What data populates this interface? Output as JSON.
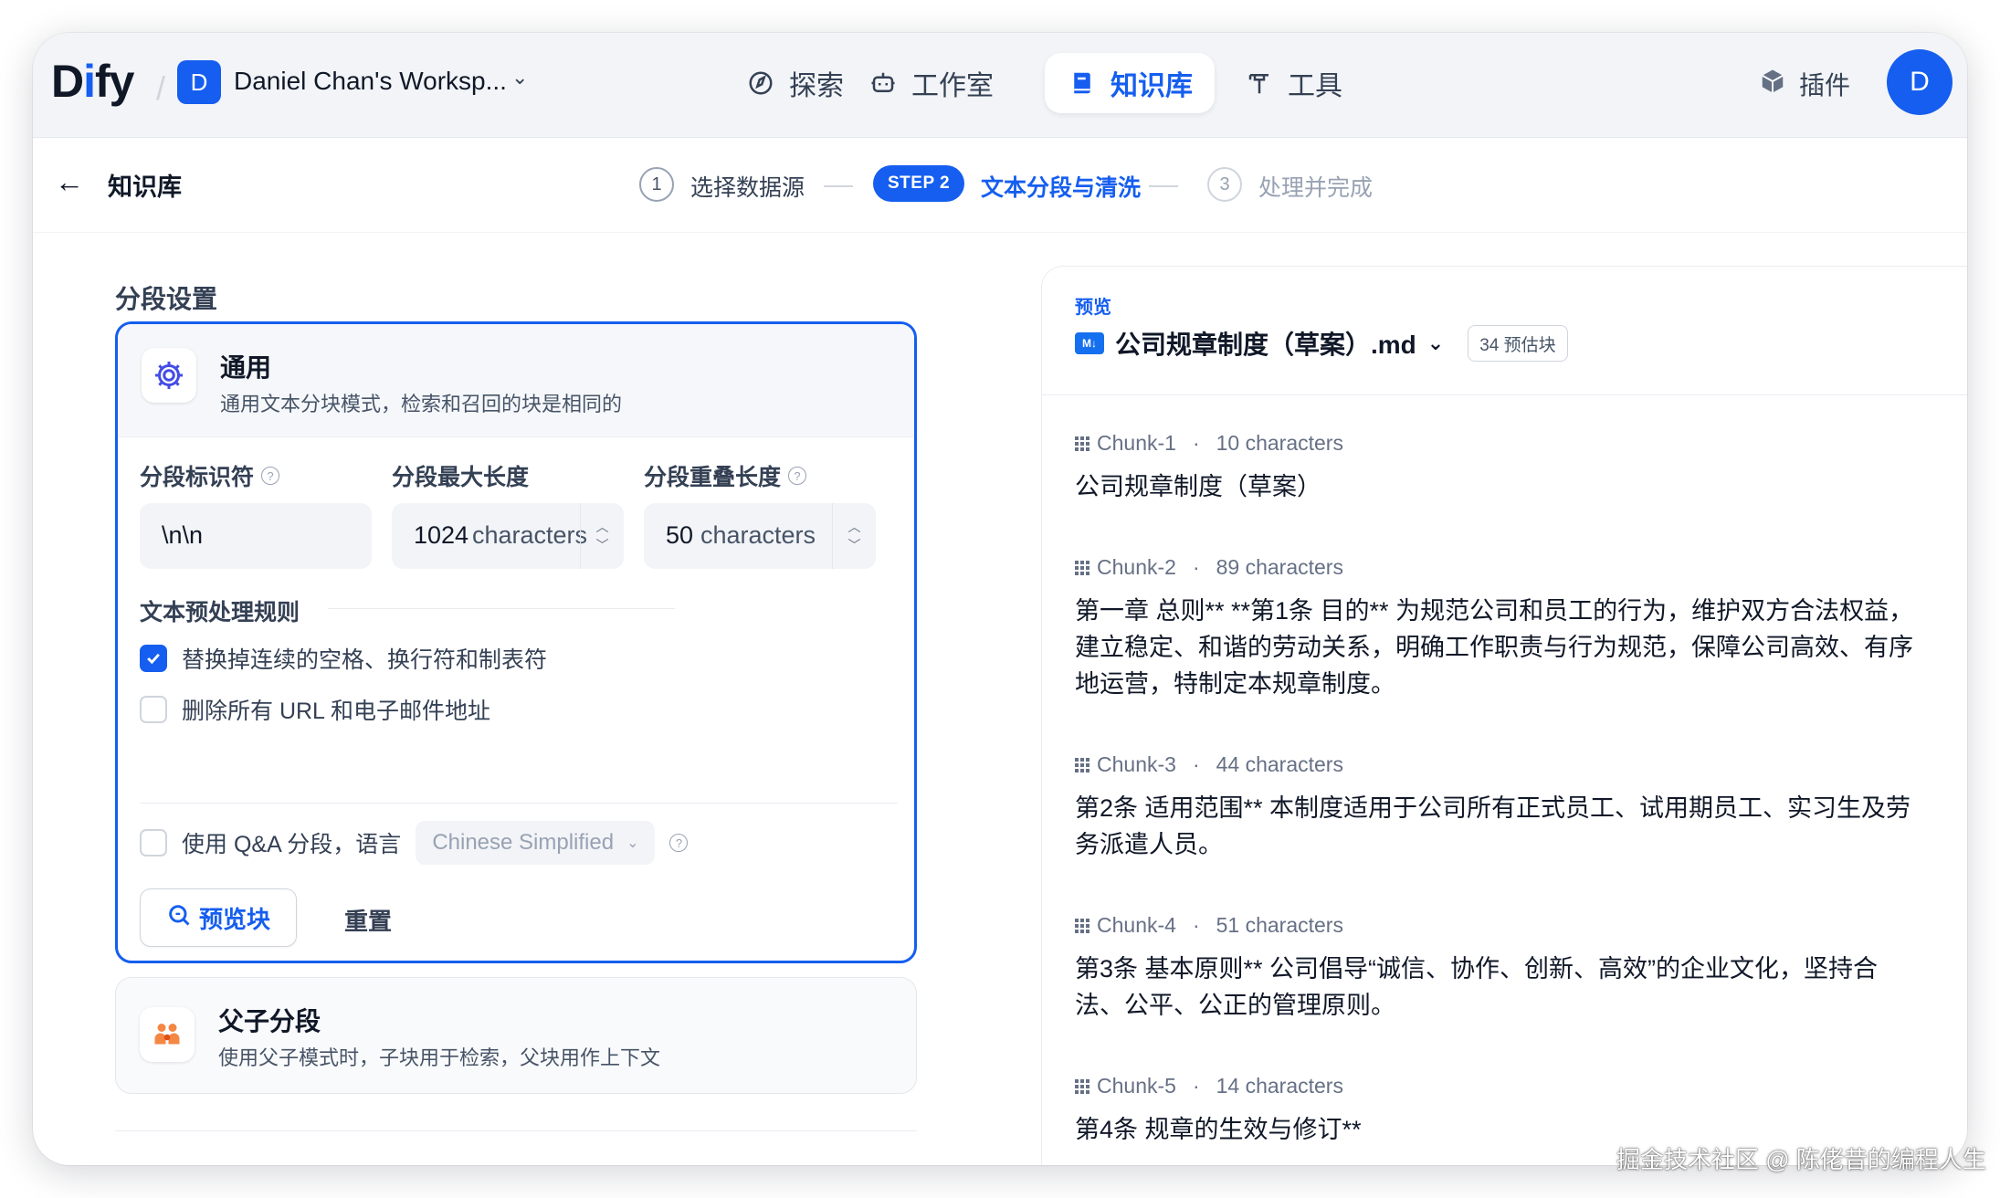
{
  "header": {
    "logo": "Dify",
    "workspace_initial": "D",
    "workspace_name": "Daniel Chan's Worksp...",
    "nav": [
      {
        "label": "探索",
        "icon": "compass-icon"
      },
      {
        "label": "工作室",
        "icon": "robot-icon"
      },
      {
        "label": "知识库",
        "icon": "book-icon",
        "active": true
      },
      {
        "label": "工具",
        "icon": "hammer-icon"
      }
    ],
    "plugins_label": "插件",
    "avatar_initial": "D"
  },
  "stepbar": {
    "back_label": "知识库",
    "step1_num": "1",
    "step1_label": "选择数据源",
    "step2_pill": "STEP 2",
    "step2_label": "文本分段与清洗",
    "step3_num": "3",
    "step3_label": "处理并完成"
  },
  "settings": {
    "section_title": "分段设置",
    "general": {
      "title": "通用",
      "desc": "通用文本分块模式，检索和召回的块是相同的",
      "delimiter_label": "分段标识符",
      "delimiter_value": "\\n\\n",
      "max_len_label": "分段最大长度",
      "max_len_value": "1024",
      "max_len_unit": "characters",
      "overlap_label": "分段重叠长度",
      "overlap_value": "50",
      "overlap_unit": "characters",
      "rules_title": "文本预处理规则",
      "rule1": "替换掉连续的空格、换行符和制表符",
      "rule1_checked": true,
      "rule2": "删除所有 URL 和电子邮件地址",
      "rule2_checked": false,
      "qa_label": "使用 Q&A 分段，语言",
      "qa_language": "Chinese Simplified",
      "preview_btn": "预览块",
      "reset_btn": "重置"
    },
    "parent_child": {
      "title": "父子分段",
      "desc": "使用父子模式时，子块用于检索，父块用作上下文"
    }
  },
  "preview": {
    "tag": "预览",
    "file_name": "公司规章制度（草案）.md",
    "estimate": "34 预估块",
    "chunks": [
      {
        "name": "Chunk-1",
        "chars": "10 characters",
        "text": "公司规章制度（草案）"
      },
      {
        "name": "Chunk-2",
        "chars": "89 characters",
        "text": "第一章 总则** **第1条 目的** 为规范公司和员工的行为，维护双方合法权益，建立稳定、和谐的劳动关系，明确工作职责与行为规范，保障公司高效、有序地运营，特制定本规章制度。"
      },
      {
        "name": "Chunk-3",
        "chars": "44 characters",
        "text": "第2条 适用范围** 本制度适用于公司所有正式员工、试用期员工、实习生及劳务派遣人员。"
      },
      {
        "name": "Chunk-4",
        "chars": "51 characters",
        "text": "第3条 基本原则** 公司倡导“诚信、协作、创新、高效”的企业文化，坚持合法、公平、公正的管理原则。"
      },
      {
        "name": "Chunk-5",
        "chars": "14 characters",
        "text": "第4条 规章的生效与修订**"
      }
    ]
  },
  "watermark": "掘金技术社区 @ 陈佬昔的编程人生",
  "colors": {
    "accent": "#155eef",
    "text": "#101828",
    "muted": "#667085"
  }
}
